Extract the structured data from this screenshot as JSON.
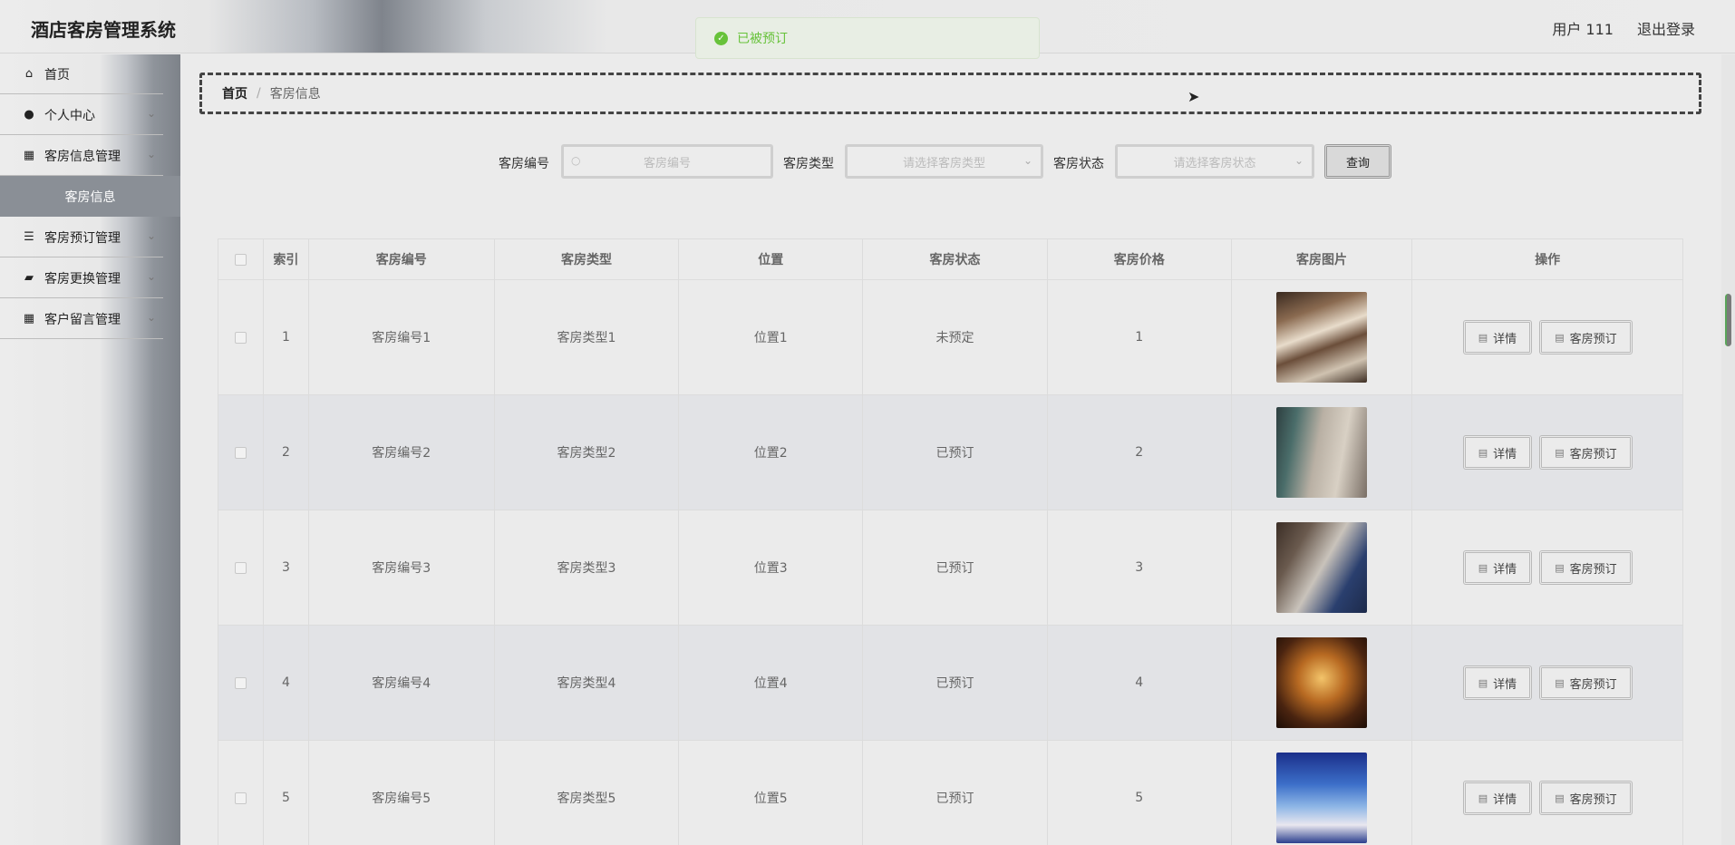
{
  "header": {
    "app_title": "酒店客房管理系统",
    "user_label": "用户 111",
    "logout_label": "退出登录"
  },
  "toast": {
    "message": "已被预订",
    "icon": "check-circle-icon"
  },
  "sidebar": {
    "items": [
      {
        "label": "首页",
        "icon": "home-icon"
      },
      {
        "label": "个人中心",
        "icon": "user-icon"
      },
      {
        "label": "客房信息管理",
        "icon": "grid-icon"
      },
      {
        "label": "客房预订管理",
        "icon": "sliders-icon"
      },
      {
        "label": "客房更换管理",
        "icon": "briefcase-icon"
      },
      {
        "label": "客户留言管理",
        "icon": "grid-icon"
      }
    ],
    "active_submenu": "客房信息"
  },
  "breadcrumb": {
    "home": "首页",
    "separator": "/",
    "current": "客房信息"
  },
  "search": {
    "room_no_label": "客房编号",
    "room_no_placeholder": "客房编号",
    "room_type_label": "客房类型",
    "room_type_placeholder": "请选择客房类型",
    "room_status_label": "客房状态",
    "room_status_placeholder": "请选择客房状态",
    "query_label": "查询"
  },
  "table": {
    "headers": [
      "索引",
      "客房编号",
      "客房类型",
      "位置",
      "客房状态",
      "客房价格",
      "客房图片",
      "操作"
    ],
    "rows": [
      {
        "index": "1",
        "room_no": "客房编号1",
        "room_type": "客房类型1",
        "location": "位置1",
        "status": "未预定",
        "price": "1"
      },
      {
        "index": "2",
        "room_no": "客房编号2",
        "room_type": "客房类型2",
        "location": "位置2",
        "status": "已预订",
        "price": "2"
      },
      {
        "index": "3",
        "room_no": "客房编号3",
        "room_type": "客房类型3",
        "location": "位置3",
        "status": "已预订",
        "price": "3"
      },
      {
        "index": "4",
        "room_no": "客房编号4",
        "room_type": "客房类型4",
        "location": "位置4",
        "status": "已预订",
        "price": "4"
      },
      {
        "index": "5",
        "room_no": "客房编号5",
        "room_type": "客房类型5",
        "location": "位置5",
        "status": "已预订",
        "price": "5"
      }
    ],
    "actions": {
      "detail": "详情",
      "book": "客房预订"
    }
  }
}
